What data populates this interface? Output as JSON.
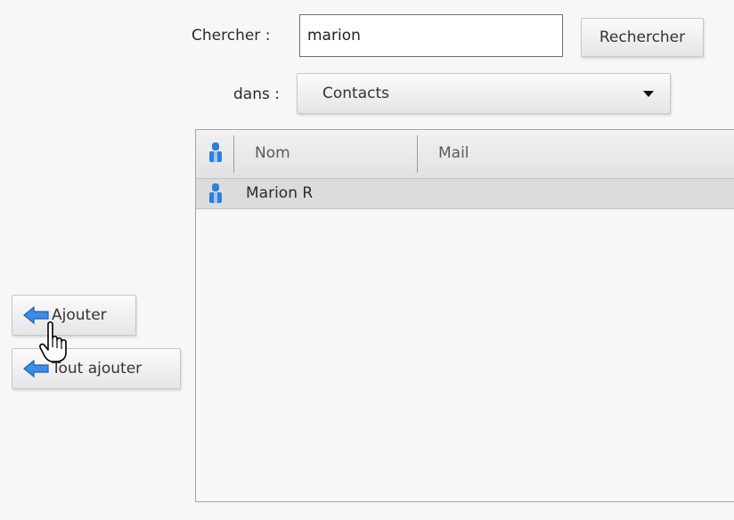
{
  "search": {
    "label": "Chercher :",
    "value": "marion",
    "button_label": "Rechercher"
  },
  "scope": {
    "label": "dans :",
    "selected": "Contacts"
  },
  "table": {
    "columns": [
      "Nom",
      "Mail"
    ],
    "rows": [
      {
        "name": "Marion R",
        "mail": ""
      }
    ]
  },
  "actions": {
    "add_label": "Ajouter",
    "add_all_label": "Tout ajouter"
  },
  "icons": {
    "user": "user-icon",
    "arrow": "arrow-left-icon",
    "cursor": "hand-pointer-icon"
  },
  "colors": {
    "icon_blue": "#2f7fd8",
    "row_selected": "#dcdcdc"
  }
}
